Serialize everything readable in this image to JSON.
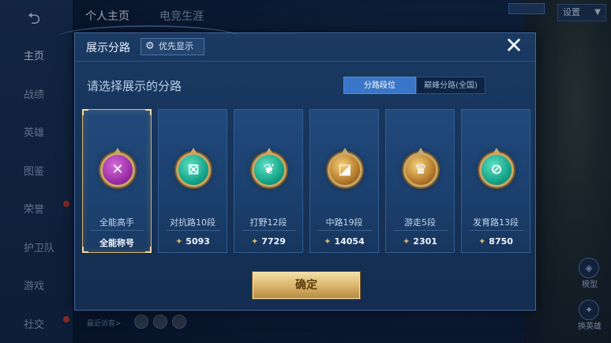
{
  "background": {
    "nav": [
      {
        "label": "主页",
        "active": true
      },
      {
        "label": "战绩"
      },
      {
        "label": "英雄"
      },
      {
        "label": "图鉴"
      },
      {
        "label": "荣誉",
        "dot": true
      },
      {
        "label": "护卫队"
      },
      {
        "label": "游戏"
      },
      {
        "label": "社交",
        "dot": true
      }
    ],
    "tabs": [
      "个人主页",
      "电竞生涯"
    ],
    "settings_label": "设置",
    "right_labels": {
      "model": "模型",
      "change_hero": "换英雄"
    },
    "recent_visitors": "最近访客>"
  },
  "modal": {
    "title": "展示分路",
    "priority_label": "优先显示",
    "close_glyph": "✕",
    "subtitle": "请选择展示的分路",
    "segments": [
      {
        "label": "分路段位",
        "active": true
      },
      {
        "label": "巅峰分路(全国)",
        "active": false
      }
    ],
    "cards": [
      {
        "name": "全能高手",
        "value": "全能称号",
        "emblem": "purple",
        "glyph": "✕",
        "selected": true,
        "show_star": false
      },
      {
        "name": "对抗路10段",
        "value": "5093",
        "emblem": "teal",
        "glyph": "⊠",
        "selected": false,
        "show_star": true
      },
      {
        "name": "打野12段",
        "value": "7729",
        "emblem": "teal",
        "glyph": "❦",
        "selected": false,
        "show_star": true
      },
      {
        "name": "中路19段",
        "value": "14054",
        "emblem": "gold",
        "glyph": "◪",
        "selected": false,
        "show_star": true
      },
      {
        "name": "游走5段",
        "value": "2301",
        "emblem": "gold",
        "glyph": "♛",
        "selected": false,
        "show_star": true
      },
      {
        "name": "发育路13段",
        "value": "8750",
        "emblem": "teal",
        "glyph": "⊘",
        "selected": false,
        "show_star": true
      }
    ],
    "confirm_label": "确定"
  },
  "colors": {
    "accent_blue": "#3a76c8",
    "gold_border": "#d7b36a",
    "confirm_gold": "#d9b26a",
    "panel_bg": "#17345a"
  }
}
